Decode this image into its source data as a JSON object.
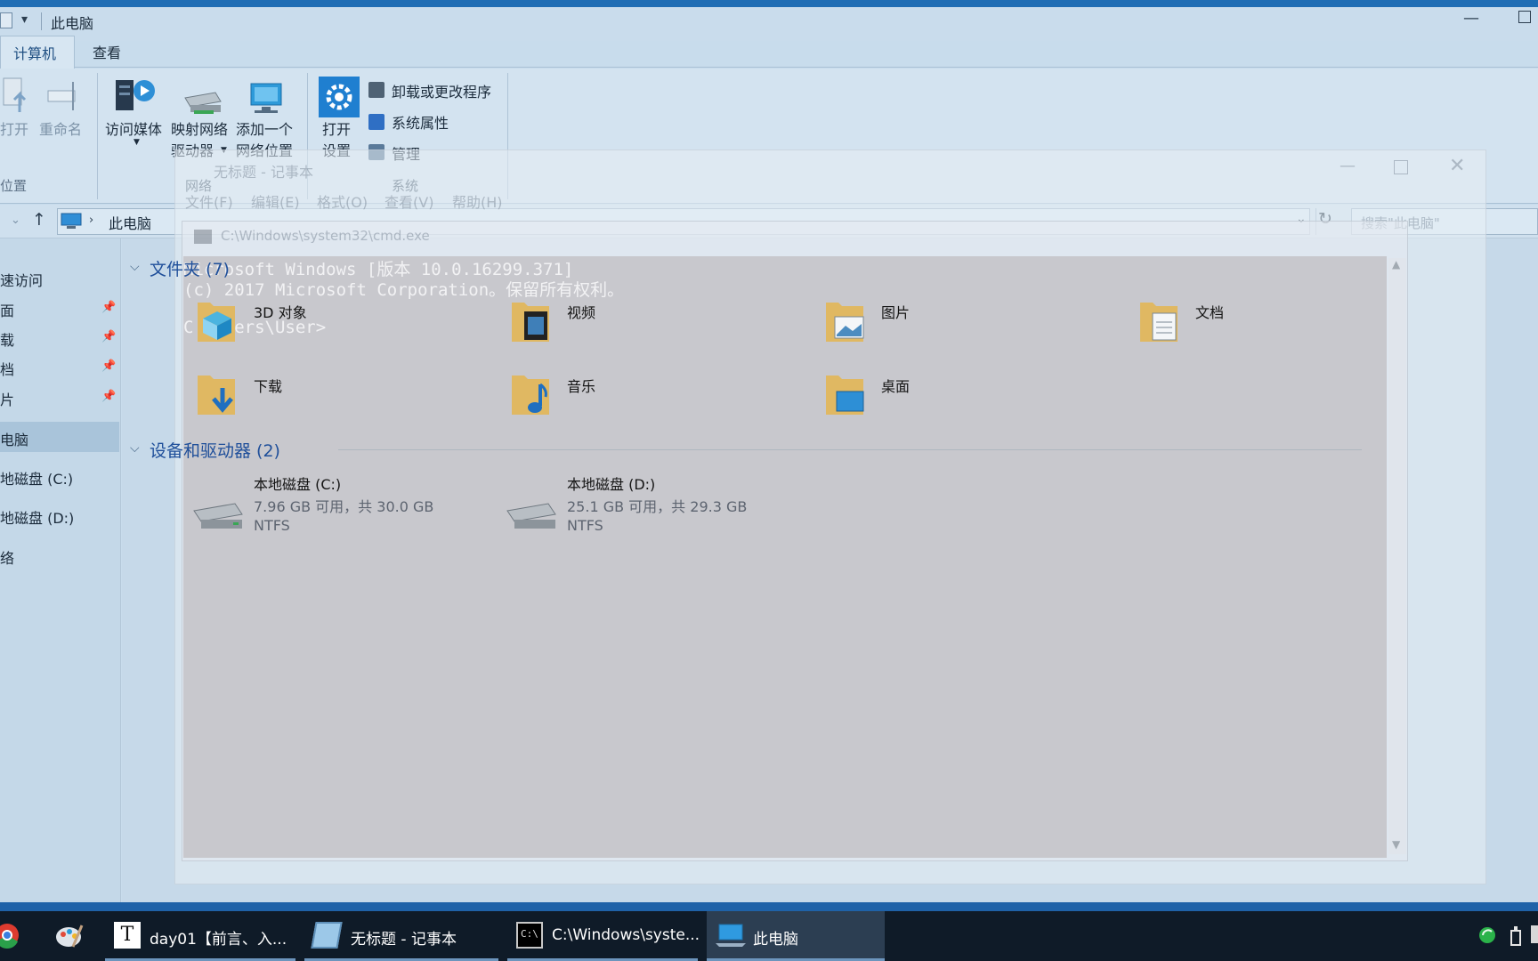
{
  "explorer": {
    "title": "此电脑",
    "tabs": [
      "计算机",
      "查看"
    ],
    "ribbon": {
      "location": {
        "open": "打开",
        "rename": "重命名",
        "group": "位置"
      },
      "network": {
        "access_media": "访问媒体",
        "map_drive_1": "映射网络",
        "map_drive_2": "驱动器",
        "add_location_1": "添加一个",
        "add_location_2": "网络位置",
        "group": "网络"
      },
      "system": {
        "open_settings_1": "打开",
        "open_settings_2": "设置",
        "uninstall": "卸载或更改程序",
        "properties": "系统属性",
        "manage": "管理",
        "group": "系统"
      }
    },
    "address": {
      "path": "此电脑",
      "search_placeholder": "搜索\"此电脑\""
    },
    "nav": {
      "quick_access": "速访问",
      "desktop": "面",
      "downloads": "载",
      "documents": "档",
      "pictures": "片",
      "this_pc": "电脑",
      "drive_c": "地磁盘 (C:)",
      "drive_d": "地磁盘 (D:)",
      "network": "络"
    },
    "sections": {
      "folders": "文件夹 (7)",
      "devices": "设备和驱动器 (2)"
    },
    "folders": [
      "3D 对象",
      "视频",
      "图片",
      "文档",
      "下载",
      "音乐",
      "桌面"
    ],
    "drives": [
      {
        "name": "本地磁盘 (C:)",
        "space": "7.96 GB 可用，共 30.0 GB",
        "fs": "NTFS"
      },
      {
        "name": "本地磁盘 (D:)",
        "space": "25.1 GB 可用，共 29.3 GB",
        "fs": "NTFS"
      }
    ]
  },
  "notepad": {
    "title": "无标题 - 记事本",
    "menu": [
      "文件(F)",
      "编辑(E)",
      "格式(O)",
      "查看(V)",
      "帮助(H)"
    ]
  },
  "cmd": {
    "title": "C:\\Windows\\system32\\cmd.exe",
    "lines": [
      "Microsoft Windows [版本 10.0.16299.371]",
      "(c) 2017 Microsoft Corporation。保留所有权利。",
      "",
      "C:\\Users\\User>"
    ]
  },
  "taskbar": {
    "items": [
      {
        "label": "day01【前言、入..."
      },
      {
        "label": "无标题 - 记事本"
      },
      {
        "label": "C:\\Windows\\syste..."
      },
      {
        "label": "此电脑"
      }
    ]
  },
  "colors": {
    "accent": "#1f6db4",
    "taskbar": "#0f1b28",
    "link": "#1f4f9a"
  }
}
